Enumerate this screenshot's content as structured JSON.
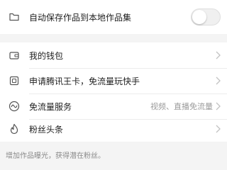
{
  "settings": {
    "auto_save": {
      "label": "自动保存作品到本地作品集",
      "enabled": false,
      "icon": "folder-icon"
    }
  },
  "menu": {
    "wallet": {
      "label": "我的钱包",
      "icon": "wallet-icon"
    },
    "wangka": {
      "label": "申请腾讯王卡，免流量玩快手",
      "icon": "card-icon"
    },
    "free_data": {
      "label": "免流量服务",
      "value": "视频、直播免流量",
      "icon": "wave-icon"
    },
    "fans": {
      "label": "粉丝头条",
      "icon": "flame-icon"
    }
  },
  "footer": {
    "note": "增加作品曝光，获得潜在粉丝。"
  },
  "colors": {
    "background": "#f4f4f4",
    "card": "#ffffff",
    "text": "#1e1e1e",
    "secondary": "#9a9a9a",
    "divider": "#ececec"
  }
}
